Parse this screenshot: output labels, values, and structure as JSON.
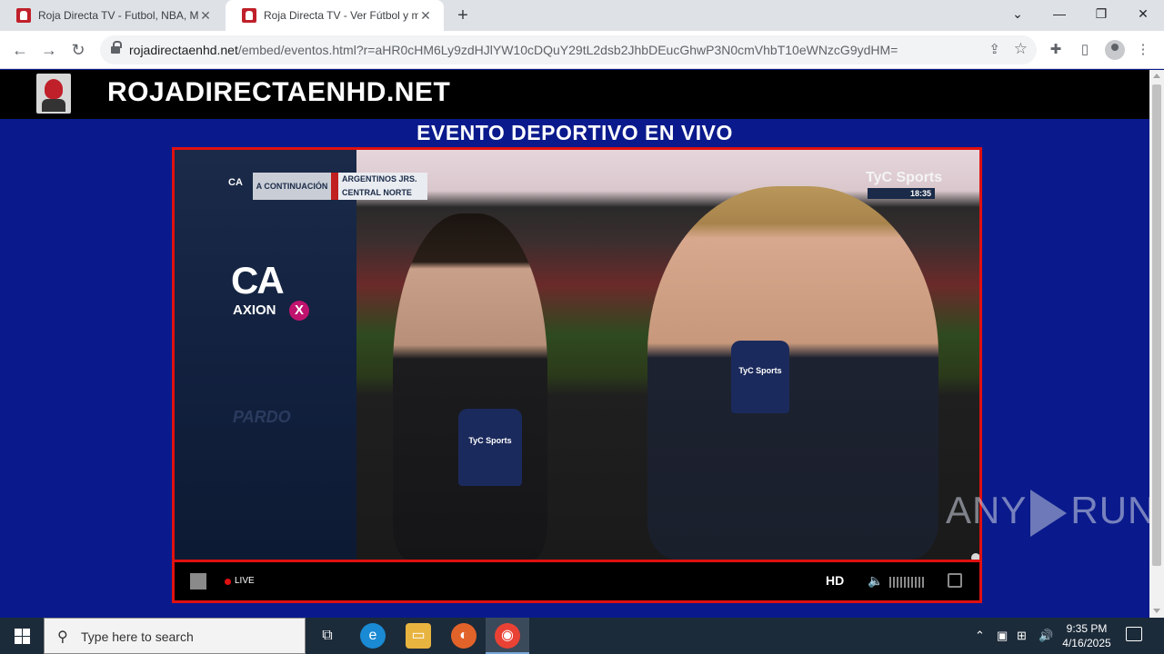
{
  "browser": {
    "tabs": [
      {
        "title": "Roja Directa TV - Futbol, NBA, M",
        "active": false
      },
      {
        "title": "Roja Directa TV - Ver Fútbol y m",
        "active": true
      }
    ],
    "url_host": "rojadirectaenhd.net",
    "url_path": "/embed/eventos.html?r=aHR0cHM6Ly9zdHJlYW10cDQuY29tL2dsb2JhbDEucGhwP3N0cmVhbT10eWNzcG9ydHM="
  },
  "site": {
    "title": "ROJADIRECTAENHD.NET",
    "event_title": "EVENTO DEPORTIVO EN VIVO"
  },
  "video": {
    "next_label": "A CONTINUACIÓN",
    "team_home": "ARGENTINOS JRS.",
    "team_away": "CENTRAL NORTE",
    "channel": "TyC Sports",
    "channel_time": "18:35",
    "sponsor_mini": "CA",
    "sponsor_logo": "CA",
    "sponsor_text": "AXION",
    "sponsor_x": "X",
    "pardo": "PARDO",
    "mic_label": "TyC Sports"
  },
  "player_controls": {
    "live_label": "LIVE",
    "quality": "HD"
  },
  "watermark": {
    "left": "ANY",
    "right": "RUN"
  },
  "taskbar": {
    "search_placeholder": "Type here to search",
    "time": "9:35 PM",
    "date": "4/16/2025"
  }
}
